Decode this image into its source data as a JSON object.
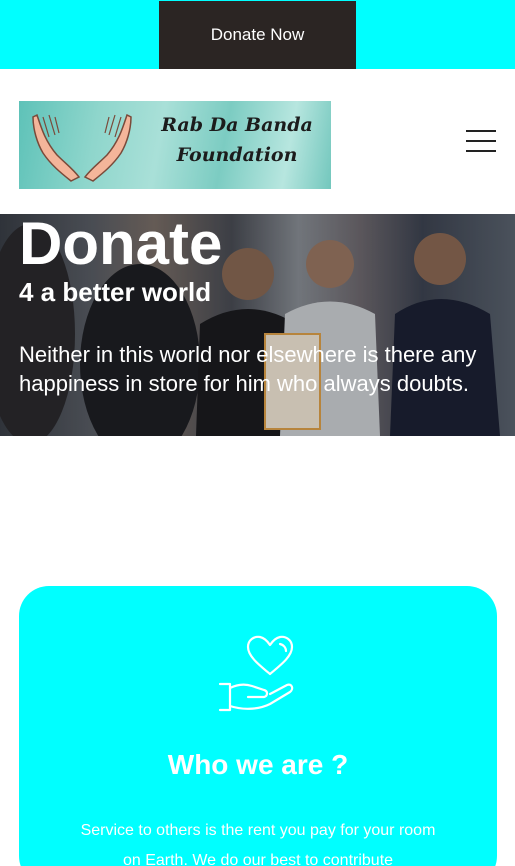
{
  "topbar": {
    "donate_label": "Donate Now",
    "bg_color": "#00ffff",
    "button_color": "#2b2523"
  },
  "header": {
    "logo": {
      "line1": "Rab Da Banda",
      "line2": "Foundation"
    },
    "menu_icon": "hamburger-menu-icon"
  },
  "hero": {
    "title": "Donate",
    "subtitle": "4 a better world",
    "quote": "Neither in this world nor elsewhere is there any happiness in store for him who always doubts."
  },
  "about": {
    "icon": "heart-in-hand-icon",
    "title": "Who we are ?",
    "text": "Service to others is the rent you pay for your room on Earth. We do our best to contribute",
    "bg_color": "#00ffff"
  }
}
